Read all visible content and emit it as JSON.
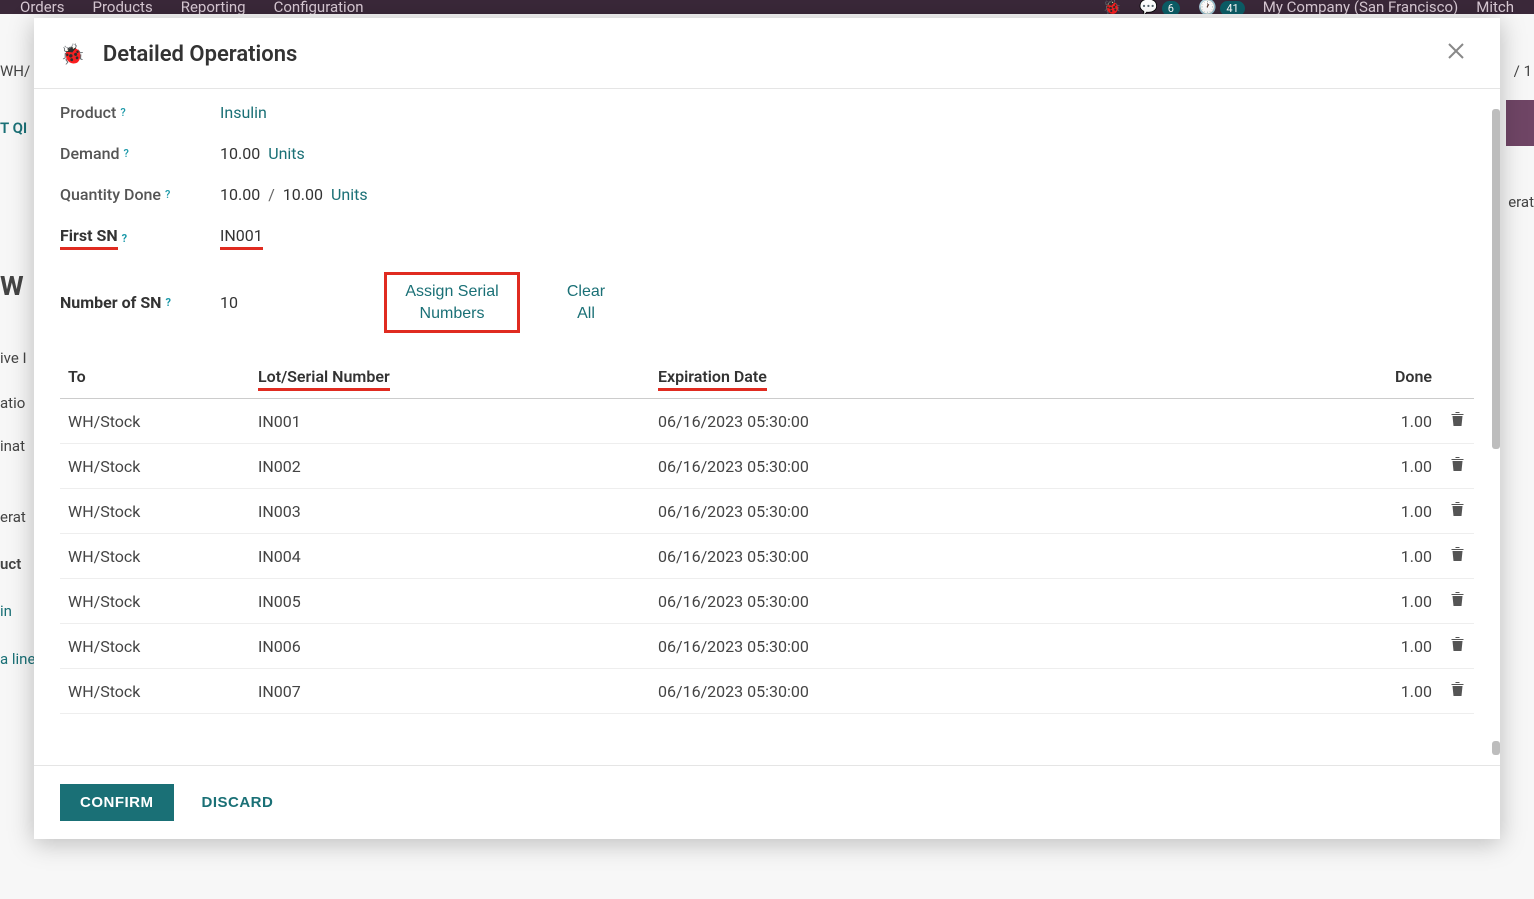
{
  "bg": {
    "menu": [
      "Orders",
      "Products",
      "Reporting",
      "Configuration"
    ],
    "msg_count": "6",
    "activity_count": "41",
    "company": "My Company (San Francisco)",
    "user": "Mitch",
    "wh": "WH/",
    "pager": "/ 1",
    "qi": "T QI",
    "erat": "erat",
    "ive": "ive I",
    "atio": "atio",
    "inat": "inat",
    "uct": "uct",
    "in": "in",
    "aline": "a line",
    "w": "W"
  },
  "modal": {
    "title": "Detailed Operations",
    "product_label": "Product",
    "product_value": "Insulin",
    "demand_label": "Demand",
    "demand_value": "10.00",
    "demand_unit": "Units",
    "qty_label": "Quantity Done",
    "qty_value": "10.00",
    "qty_sep": "/",
    "qty_total": "10.00",
    "qty_unit": "Units",
    "first_sn_label": "First SN",
    "first_sn_value": "IN001",
    "num_sn_label": "Number of SN",
    "num_sn_value": "10",
    "assign_btn": "Assign Serial Numbers",
    "clear_btn": "Clear All",
    "cols": {
      "to": "To",
      "lot": "Lot/Serial Number",
      "exp": "Expiration Date",
      "done": "Done"
    },
    "rows": [
      {
        "to": "WH/Stock",
        "lot": "IN001",
        "exp": "06/16/2023 05:30:00",
        "done": "1.00"
      },
      {
        "to": "WH/Stock",
        "lot": "IN002",
        "exp": "06/16/2023 05:30:00",
        "done": "1.00"
      },
      {
        "to": "WH/Stock",
        "lot": "IN003",
        "exp": "06/16/2023 05:30:00",
        "done": "1.00"
      },
      {
        "to": "WH/Stock",
        "lot": "IN004",
        "exp": "06/16/2023 05:30:00",
        "done": "1.00"
      },
      {
        "to": "WH/Stock",
        "lot": "IN005",
        "exp": "06/16/2023 05:30:00",
        "done": "1.00"
      },
      {
        "to": "WH/Stock",
        "lot": "IN006",
        "exp": "06/16/2023 05:30:00",
        "done": "1.00"
      },
      {
        "to": "WH/Stock",
        "lot": "IN007",
        "exp": "06/16/2023 05:30:00",
        "done": "1.00"
      }
    ],
    "confirm": "CONFIRM",
    "discard": "DISCARD"
  }
}
